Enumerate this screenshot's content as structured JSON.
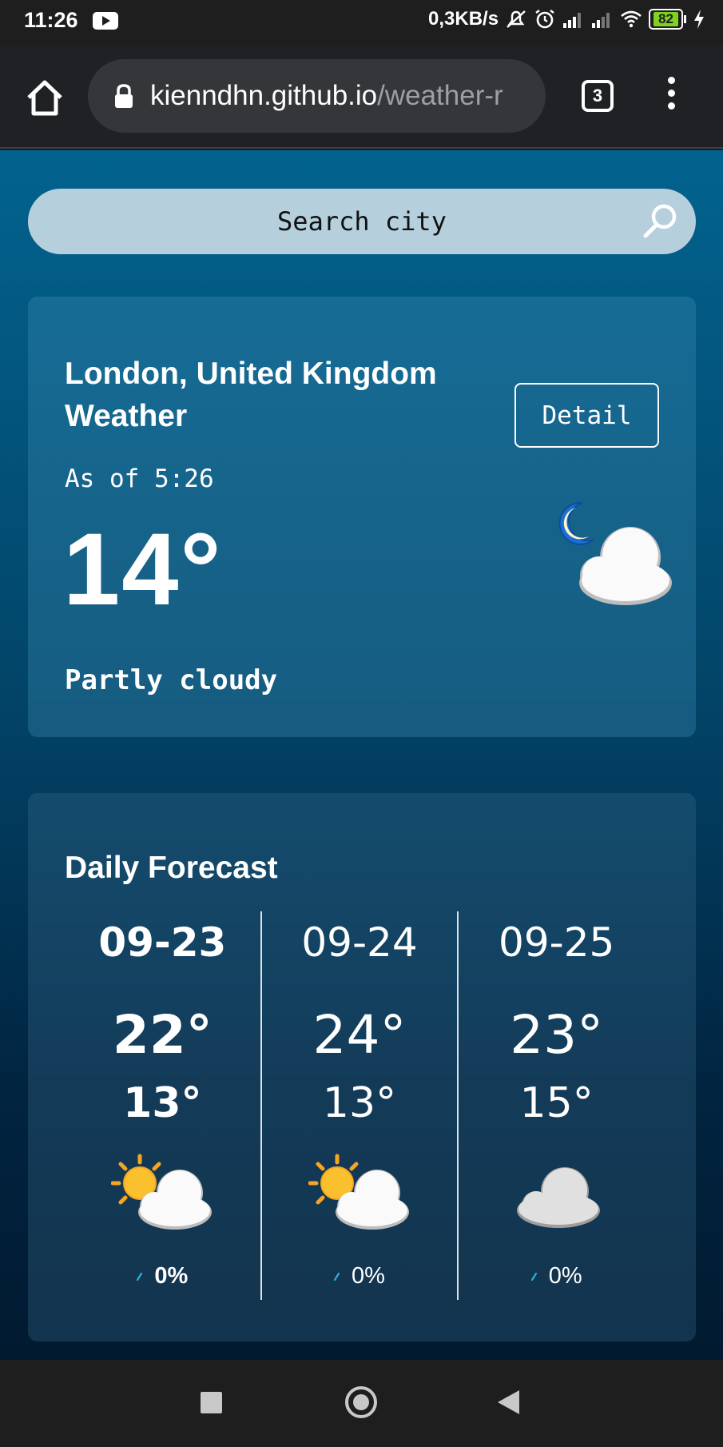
{
  "status_bar": {
    "time": "11:26",
    "net_speed": "0,3KB/s",
    "battery": "82"
  },
  "browser": {
    "url_host": "kienndhn.github.io",
    "url_path": "/weather-r",
    "tab_count": "3"
  },
  "search": {
    "placeholder": "Search city"
  },
  "current": {
    "location": "London, United Kingdom Weather",
    "detail_label": "Detail",
    "as_of": "As of 5:26",
    "temperature": "14°",
    "condition": "Partly cloudy",
    "icon": "night-partly-cloudy-icon"
  },
  "forecast": {
    "title": "Daily Forecast",
    "days": [
      {
        "date": "09-23",
        "high": "22°",
        "low": "13°",
        "rain": "0%",
        "icon": "sun-behind-cloud-icon"
      },
      {
        "date": "09-24",
        "high": "24°",
        "low": "13°",
        "rain": "0%",
        "icon": "sun-behind-cloud-icon"
      },
      {
        "date": "09-25",
        "high": "23°",
        "low": "15°",
        "rain": "0%",
        "icon": "cloud-icon"
      }
    ]
  },
  "colors": {
    "accent": "#02638f",
    "rain_drop": "#2ab0e0"
  }
}
